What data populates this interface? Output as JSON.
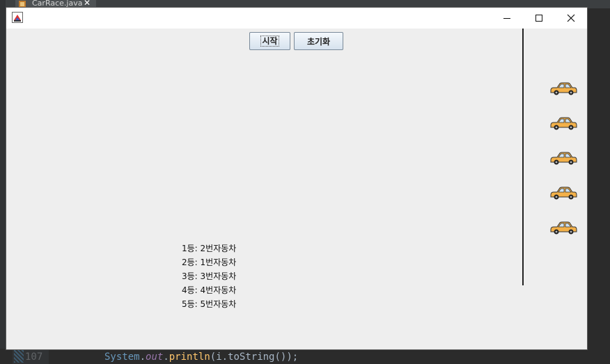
{
  "ide": {
    "tab_name": "CarRace.java",
    "tab_close": "✕",
    "line_number": "107",
    "code": {
      "class_name": "System",
      "dot1": ".",
      "field": "out",
      "dot2": ".",
      "method": "println",
      "rest": "(i.toString());"
    }
  },
  "window": {
    "title": "",
    "controls": {
      "minimize": "minimize",
      "maximize": "maximize",
      "close": "close"
    }
  },
  "toolbar": {
    "start_label": "시작",
    "reset_label": "초기화"
  },
  "cars": [
    "car-icon",
    "car-icon",
    "car-icon",
    "car-icon",
    "car-icon"
  ],
  "results": [
    "1등: 2번자동차",
    "2등: 1번자동차",
    "3등: 3번자동차",
    "4등: 4번자동차",
    "5등: 5번자동차"
  ],
  "colors": {
    "car_body": "#f3b14a",
    "button_border": "#7a8a99",
    "panel_bg": "#eeeeee"
  }
}
